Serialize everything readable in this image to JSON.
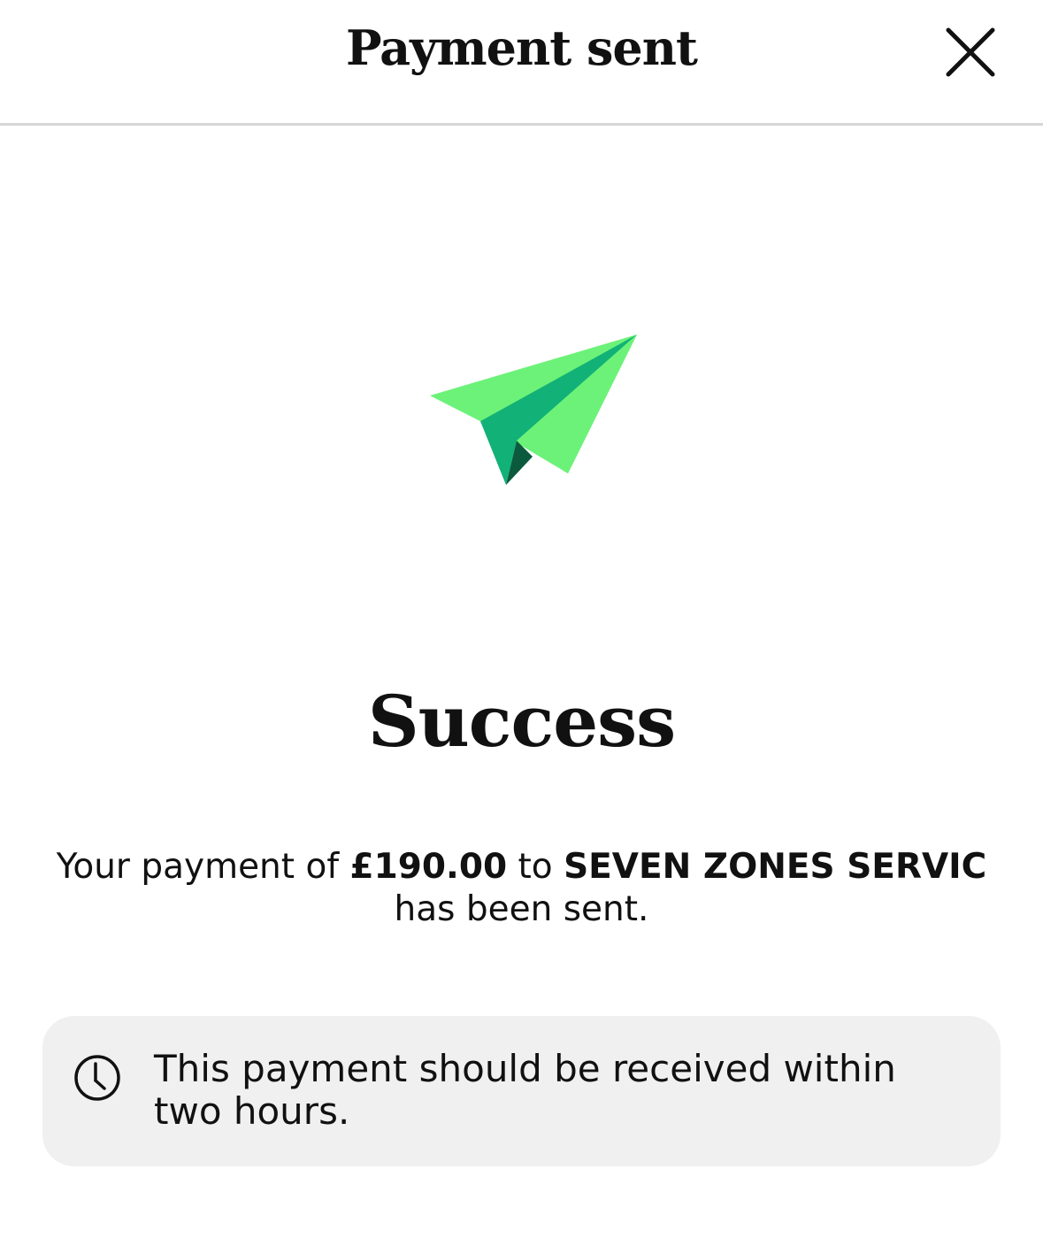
{
  "header": {
    "title": "Payment sent",
    "close_icon": "close-icon"
  },
  "hero": {
    "icon": "paper-plane-icon",
    "colors": {
      "light": "#6cf278",
      "mid": "#12b177",
      "dark": "#0b5a3e"
    }
  },
  "result": {
    "title": "Success",
    "message_prefix": "Your payment of ",
    "amount": "£190.00",
    "message_middle": " to ",
    "recipient": "SEVEN ZONES SERVIC",
    "message_suffix": "has been sent."
  },
  "info_card": {
    "icon": "clock-icon",
    "text": "This payment should be received within two hours."
  }
}
